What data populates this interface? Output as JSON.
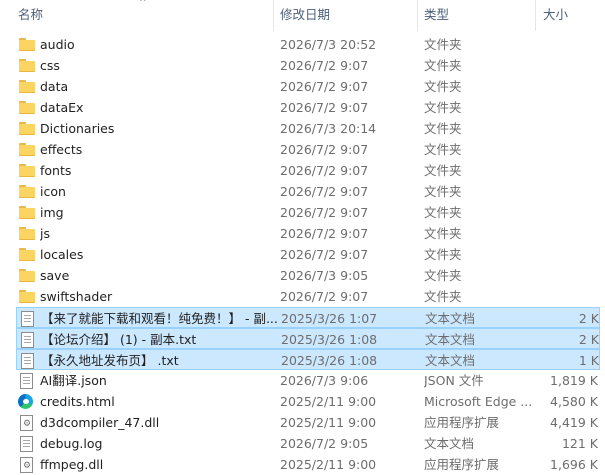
{
  "columns": {
    "name": "名称",
    "date": "修改日期",
    "type": "类型",
    "size": "大小"
  },
  "files": [
    {
      "name": "audio",
      "date": "2026/7/3 20:52",
      "type": "文件夹",
      "size": "",
      "icon": "folder-icon",
      "selected": false
    },
    {
      "name": "css",
      "date": "2026/7/2 9:07",
      "type": "文件夹",
      "size": "",
      "icon": "folder-icon",
      "selected": false
    },
    {
      "name": "data",
      "date": "2026/7/2 9:07",
      "type": "文件夹",
      "size": "",
      "icon": "folder-icon",
      "selected": false
    },
    {
      "name": "dataEx",
      "date": "2026/7/2 9:07",
      "type": "文件夹",
      "size": "",
      "icon": "folder-icon",
      "selected": false
    },
    {
      "name": "Dictionaries",
      "date": "2026/7/3 20:14",
      "type": "文件夹",
      "size": "",
      "icon": "folder-icon",
      "selected": false
    },
    {
      "name": "effects",
      "date": "2026/7/2 9:07",
      "type": "文件夹",
      "size": "",
      "icon": "folder-icon",
      "selected": false
    },
    {
      "name": "fonts",
      "date": "2026/7/2 9:07",
      "type": "文件夹",
      "size": "",
      "icon": "folder-icon",
      "selected": false
    },
    {
      "name": "icon",
      "date": "2026/7/2 9:07",
      "type": "文件夹",
      "size": "",
      "icon": "folder-icon",
      "selected": false
    },
    {
      "name": "img",
      "date": "2026/7/2 9:07",
      "type": "文件夹",
      "size": "",
      "icon": "folder-icon",
      "selected": false
    },
    {
      "name": "js",
      "date": "2026/7/2 9:07",
      "type": "文件夹",
      "size": "",
      "icon": "folder-icon",
      "selected": false
    },
    {
      "name": "locales",
      "date": "2026/7/2 9:07",
      "type": "文件夹",
      "size": "",
      "icon": "folder-icon",
      "selected": false
    },
    {
      "name": "save",
      "date": "2026/7/3 9:05",
      "type": "文件夹",
      "size": "",
      "icon": "folder-icon",
      "selected": false
    },
    {
      "name": "swiftshader",
      "date": "2026/7/2 9:07",
      "type": "文件夹",
      "size": "",
      "icon": "folder-icon",
      "selected": false
    },
    {
      "name": "【来了就能下载和观看！纯免费！】 - 副...",
      "date": "2025/3/26 1:07",
      "type": "文本文档",
      "size": "2 K",
      "icon": "text-document-icon",
      "selected": true
    },
    {
      "name": "【论坛介绍】 (1) - 副本.txt",
      "date": "2025/3/26 1:08",
      "type": "文本文档",
      "size": "2 K",
      "icon": "text-document-icon",
      "selected": true
    },
    {
      "name": "【永久地址发布页】 .txt",
      "date": "2025/3/26 1:08",
      "type": "文本文档",
      "size": "1 K",
      "icon": "text-document-icon",
      "selected": true
    },
    {
      "name": "AI翻译.json",
      "date": "2026/7/3 9:06",
      "type": "JSON 文件",
      "size": "1,819 K",
      "icon": "json-file-icon",
      "selected": false
    },
    {
      "name": "credits.html",
      "date": "2025/2/11 9:00",
      "type": "Microsoft Edge ...",
      "size": "4,580 K",
      "icon": "edge-html-icon",
      "selected": false
    },
    {
      "name": "d3dcompiler_47.dll",
      "date": "2025/2/11 9:00",
      "type": "应用程序扩展",
      "size": "4,419 K",
      "icon": "dll-file-icon",
      "selected": false
    },
    {
      "name": "debug.log",
      "date": "2026/7/2 9:05",
      "type": "文本文档",
      "size": "121 K",
      "icon": "text-document-icon",
      "selected": false
    },
    {
      "name": "ffmpeg.dll",
      "date": "2025/2/11 9:00",
      "type": "应用程序扩展",
      "size": "1,696 K",
      "icon": "dll-file-icon",
      "selected": false
    }
  ]
}
